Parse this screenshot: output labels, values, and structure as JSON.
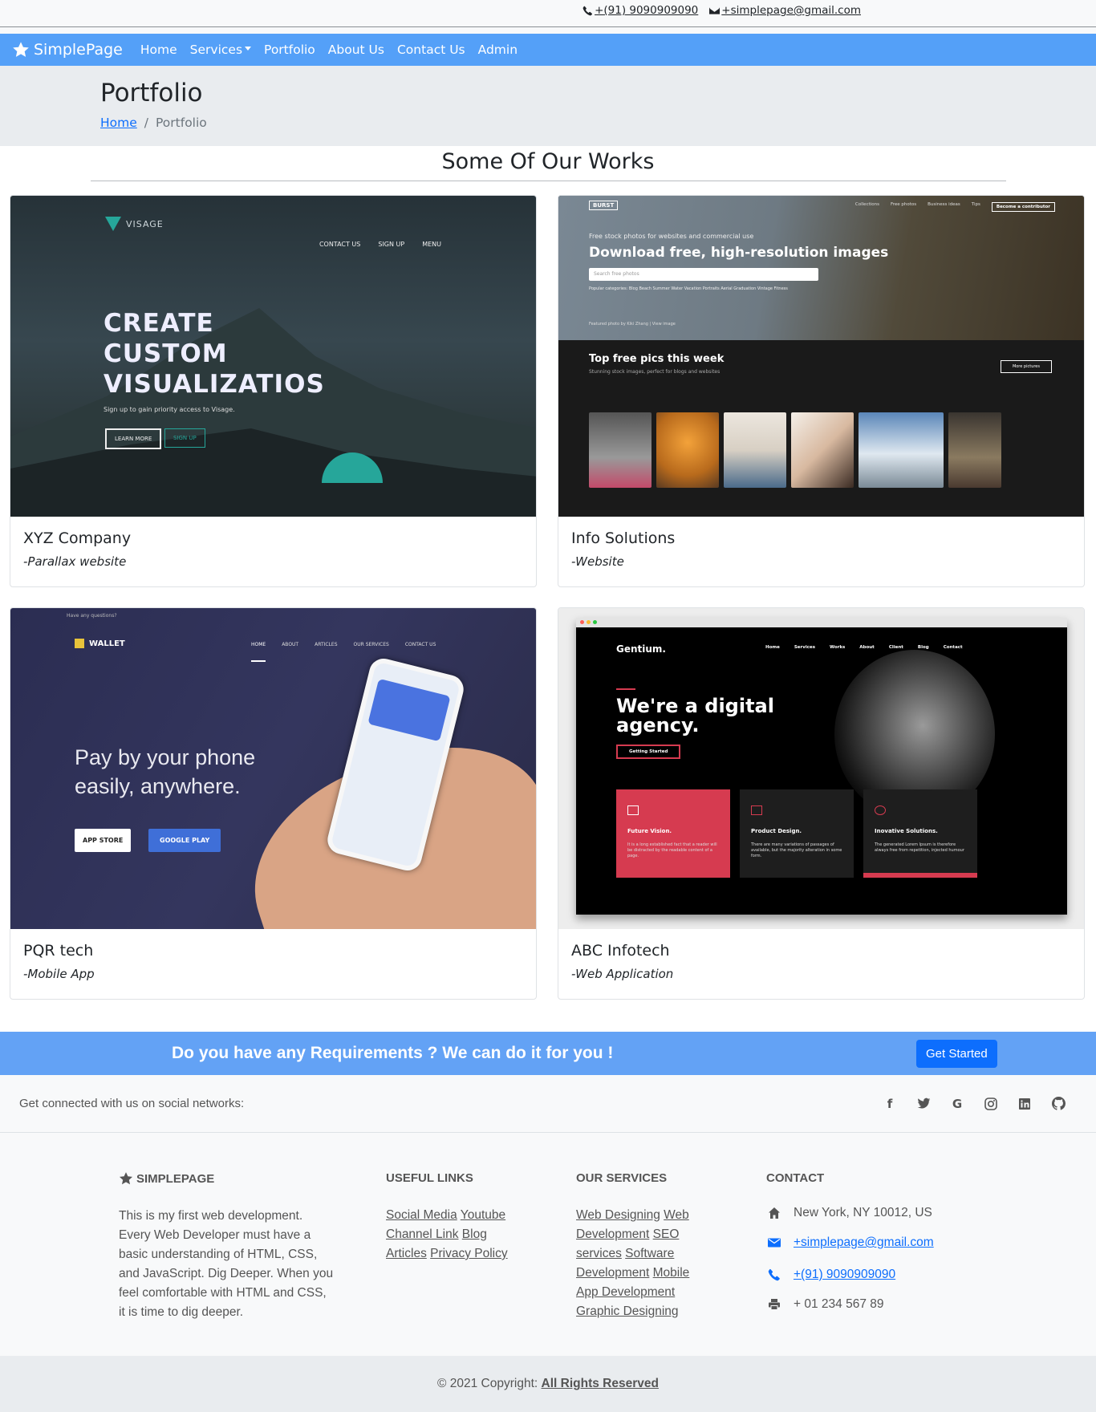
{
  "topbar": {
    "phone": "+(91) 9090909090",
    "email": "+simplepage@gmail.com"
  },
  "navbar": {
    "brand": "SimplePage",
    "items": [
      "Home",
      "Services",
      "Portfolio",
      "About Us",
      "Contact Us",
      "Admin"
    ]
  },
  "header": {
    "title": "Portfolio",
    "breadcrumb_home": "Home",
    "breadcrumb_current": "Portfolio"
  },
  "works": {
    "title": "Some Of Our Works",
    "cards": [
      {
        "title": "XYZ Company",
        "subtitle": "-Parallax website"
      },
      {
        "title": "Info Solutions",
        "subtitle": "-Website"
      },
      {
        "title": "PQR tech",
        "subtitle": "-Mobile App"
      },
      {
        "title": "ABC Infotech",
        "subtitle": "-Web Application"
      }
    ],
    "thumb1": {
      "logo": "VISAGE",
      "menu": [
        "CONTACT US",
        "SIGN UP",
        "MENU"
      ],
      "headline_1": "CREATE",
      "headline_2": "CUSTOM",
      "headline_3": "VISUALIZATIOS",
      "tagline": "Sign up to gain priority access to Visage.",
      "btn1": "LEARN MORE",
      "btn2": "SIGN UP"
    },
    "thumb2": {
      "logo": "BURST",
      "links": [
        "Collections",
        "Free photos",
        "Business ideas",
        "Tips"
      ],
      "contributor": "Become a contributor",
      "kicker": "Free stock photos for websites and commercial use",
      "headline": "Download free, high-resolution images",
      "search": "Search free photos",
      "categories": "Popular categories: Blog Beach Summer Water Vacation Portraits Aerial Graduation Vintage Fitness",
      "featured": "Featured photo by Kiki Zhang | View image",
      "section": "Top free pics this week",
      "section_sub": "Stunning stock images, perfect for blogs and websites",
      "more": "More pictures"
    },
    "thumb3": {
      "topline": "Have any questions?",
      "logo": "WALLET",
      "menu": [
        "HOME",
        "ABOUT",
        "ARTICLES",
        "OUR SERVICES",
        "CONTACT US"
      ],
      "headline_1": "Pay by your phone",
      "headline_2": "easily, anywhere.",
      "store": "APP STORE",
      "play": "GOOGLE PLAY"
    },
    "thumb4": {
      "logo": "Gentium.",
      "menu": [
        "Home",
        "Services",
        "Works",
        "About",
        "Client",
        "Blog",
        "Contact"
      ],
      "headline_1": "We're a digital",
      "headline_2": "agency.",
      "button": "Getting Started",
      "boxes": [
        {
          "title": "Future Vision.",
          "text": "It is a long established fact that a reader will be distracted by the readable content of a page."
        },
        {
          "title": "Product Design.",
          "text": "There are many variations of passages of available, but the majority alteration in some form."
        },
        {
          "title": "Inovative Solutions.",
          "text": "The generated Lorem Ipsum is therefore always free from repetition, injected humour"
        }
      ]
    }
  },
  "cta": {
    "text": "Do you have any Requirements ? We can do it for you !",
    "button": "Get Started"
  },
  "social": {
    "text": "Get connected with us on social networks:",
    "icons": [
      "facebook-icon",
      "twitter-icon",
      "google-icon",
      "instagram-icon",
      "linkedin-icon",
      "github-icon"
    ]
  },
  "footer": {
    "brand": "SIMPLEPAGE",
    "about": "This is my first web development. Every Web Developer must have a basic understanding of HTML, CSS, and JavaScript. Dig Deeper. When you feel comfortable with HTML and CSS, it is time to dig deeper.",
    "useful_title": "USEFUL LINKS",
    "useful": [
      "Social Media",
      "Youtube Channel Link",
      "Blog Articles",
      "Privacy Policy"
    ],
    "services_title": "OUR SERVICES",
    "services": [
      "Web Designing",
      "Web Development",
      "SEO services",
      "Software Development",
      "Mobile App Development",
      "Graphic Designing"
    ],
    "contact_title": "CONTACT",
    "address": "New York, NY 10012, US",
    "email": "+simplepage@gmail.com",
    "phone": "+(91) 9090909090",
    "fax": "+ 01 234 567 89"
  },
  "copyright": {
    "text": "© 2021 Copyright: ",
    "link": "All Rights Reserved"
  },
  "colors": {
    "navbar": "#54a0f8",
    "cta": "#63a2f5",
    "primary": "#0d6efd"
  }
}
